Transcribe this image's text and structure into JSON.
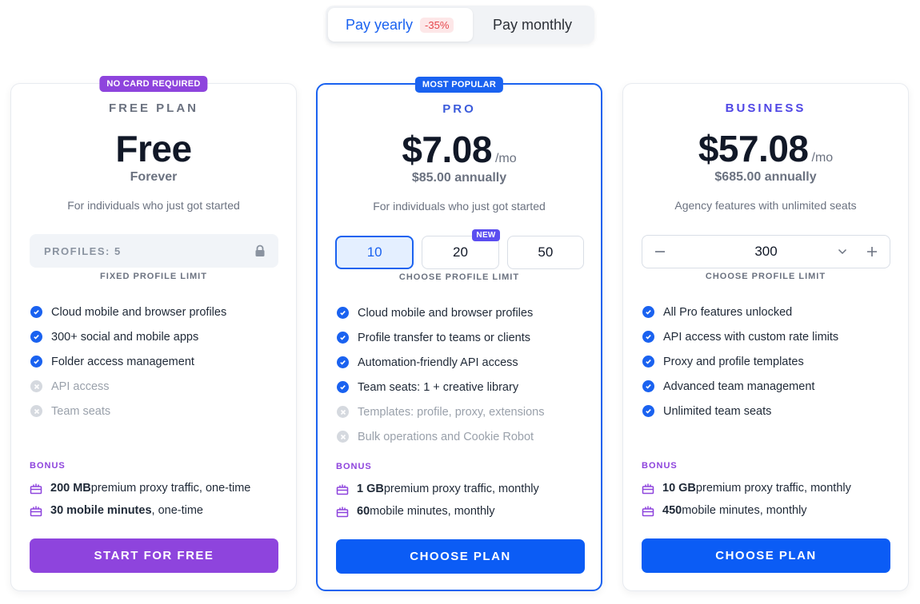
{
  "toggle": {
    "yearly_label": "Pay yearly",
    "discount": "-35%",
    "monthly_label": "Pay monthly",
    "selected": "yearly"
  },
  "plans": {
    "free": {
      "ribbon": "NO CARD REQUIRED",
      "name": "FREE PLAN",
      "price": "Free",
      "subprice": "Forever",
      "description": "For individuals who just got started",
      "profiles_label": "PROFILES: 5",
      "limit_caption": "FIXED PROFILE LIMIT",
      "features": [
        {
          "text": "Cloud mobile and browser profiles",
          "included": true
        },
        {
          "text": "300+ social and mobile apps",
          "included": true
        },
        {
          "text": "Folder access management",
          "included": true
        },
        {
          "text": "API access",
          "included": false
        },
        {
          "text": "Team seats",
          "included": false
        }
      ],
      "bonus_title": "BONUS",
      "bonus": [
        {
          "amount": "200 MB",
          "rest": " premium proxy traffic, one-time"
        },
        {
          "amount": "30 mobile minutes",
          "rest": ", one-time"
        }
      ],
      "cta": "START FOR FREE"
    },
    "pro": {
      "ribbon": "MOST POPULAR",
      "name": "PRO",
      "price": "$7.08",
      "per": "/mo",
      "subprice": "$85.00 annually",
      "description": "For individuals who just got started",
      "limit_options": [
        "10",
        "20",
        "50"
      ],
      "selected_limit": "10",
      "new_badge": "NEW",
      "limit_caption": "CHOOSE PROFILE LIMIT",
      "features": [
        {
          "text": "Cloud mobile and browser profiles",
          "included": true
        },
        {
          "text": "Profile transfer to teams or clients",
          "included": true
        },
        {
          "text": "Automation-friendly API access",
          "included": true
        },
        {
          "text": "Team seats: 1 + creative library",
          "included": true
        },
        {
          "text": "Templates: profile, proxy, extensions",
          "included": false
        },
        {
          "text": "Bulk operations and Cookie Robot",
          "included": false
        }
      ],
      "bonus_title": "BONUS",
      "bonus": [
        {
          "amount": "1 GB",
          "rest": " premium proxy traffic, monthly"
        },
        {
          "amount": "60",
          "rest": " mobile minutes, monthly"
        }
      ],
      "cta": "CHOOSE PLAN"
    },
    "business": {
      "name": "BUSINESS",
      "price": "$57.08",
      "per": "/mo",
      "subprice": "$685.00 annually",
      "description": "Agency features with unlimited seats",
      "stepper_value": "300",
      "limit_caption": "CHOOSE PROFILE LIMIT",
      "features": [
        {
          "text": "All Pro features unlocked",
          "included": true
        },
        {
          "text": "API access with custom rate limits",
          "included": true
        },
        {
          "text": "Proxy and profile templates",
          "included": true
        },
        {
          "text": "Advanced team management",
          "included": true
        },
        {
          "text": "Unlimited team seats",
          "included": true
        }
      ],
      "bonus_title": "BONUS",
      "bonus": [
        {
          "amount": "10 GB",
          "rest": " premium proxy traffic, monthly"
        },
        {
          "amount": "450",
          "rest": " mobile minutes, monthly"
        }
      ],
      "cta": "CHOOSE PLAN"
    }
  },
  "colors": {
    "brand_blue": "#1a62f0",
    "bonus_purple": "#8e44dd",
    "discount_red": "#e5484d"
  }
}
